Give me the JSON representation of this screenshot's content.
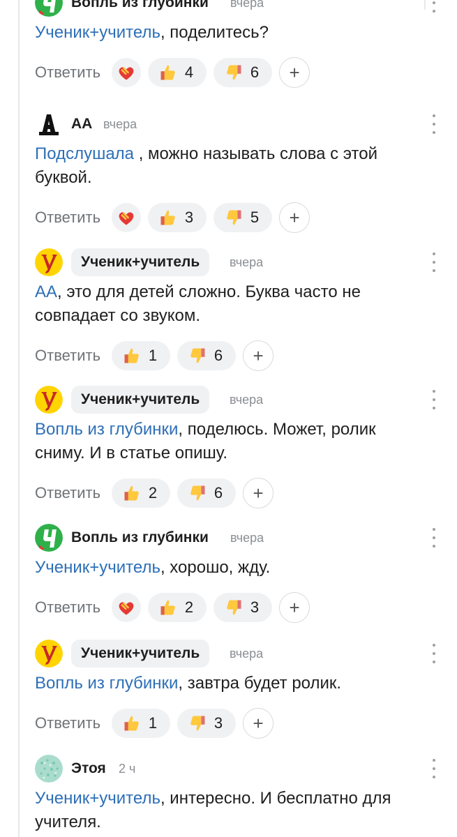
{
  "reply_label": "Ответить",
  "plus_label": "+",
  "colors": {
    "mention": "#2d6fb7",
    "chip_bg": "#f0f1f3",
    "muted": "#8a8e94"
  },
  "comments": [
    {
      "author": "Вопль из глубинки",
      "time": "вчера",
      "avatar": "green-badge",
      "mention": "Ученик+учитель",
      "text": ", поделитесь?",
      "likes": "4",
      "dislikes": "6",
      "heart": true
    },
    {
      "author": "АА",
      "time": "вчера",
      "avatar": "letter-A",
      "mention": "Подслушала",
      "text": " , можно называть слова с этой буквой.",
      "likes": "3",
      "dislikes": "5",
      "heart": true
    },
    {
      "author": "Ученик+учитель",
      "time": "вчера",
      "avatar": "yellow-U",
      "mention": "АА",
      "text": ", это для детей сложно. Буква часто не совпадает со звуком.",
      "likes": "1",
      "dislikes": "6",
      "heart": false
    },
    {
      "author": "Ученик+учитель",
      "time": "вчера",
      "avatar": "yellow-U",
      "mention": "Вопль из глубинки",
      "text": ", поделюсь. Может, ролик сниму. И в статье опишу.",
      "likes": "2",
      "dislikes": "6",
      "heart": false
    },
    {
      "author": "Вопль из глубинки",
      "time": "вчера",
      "avatar": "green-badge",
      "mention": "Ученик+учитель",
      "text": ", хорошо, жду.",
      "likes": "2",
      "dislikes": "3",
      "heart": true
    },
    {
      "author": "Ученик+учитель",
      "time": "вчера",
      "avatar": "yellow-U",
      "mention": "Вопль из глубинки",
      "text": ", завтра будет ролик.",
      "likes": "1",
      "dislikes": "3",
      "heart": false
    },
    {
      "author": "Этоя",
      "time": "2 ч",
      "avatar": "mosaic",
      "mention": "Ученик+учитель",
      "text": ", интересно. И бесплатно для учителя.",
      "likes": "",
      "dislikes": "",
      "heart": false
    }
  ]
}
